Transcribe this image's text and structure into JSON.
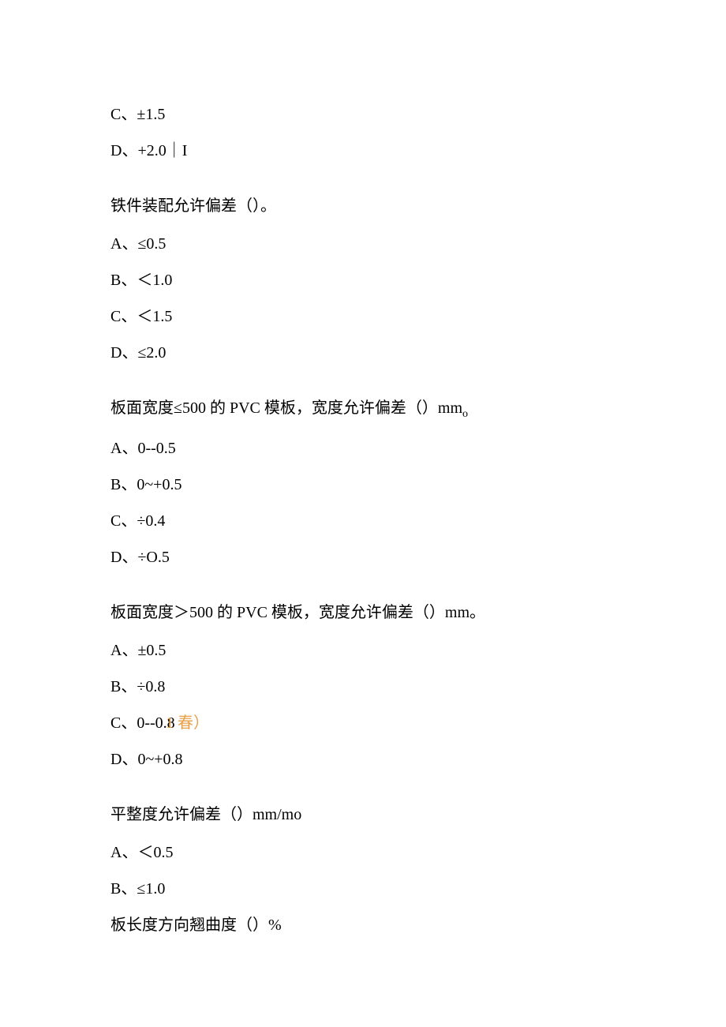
{
  "lines": {
    "opt_c1": "C、±1.5",
    "opt_d1": "D、+2.0｜I",
    "q1": "铁件装配允许偏差（）。",
    "q1_a": "A、≤0.5",
    "q1_b": "B、＜1.0",
    "q1_c": "C、＜1.5",
    "q1_d": "D、≤2.0",
    "q2_prefix": "板面宽度≤500 的 PVC 模板，宽度允许偏差（）mm",
    "q2_suffix": "o",
    "q2_a": "A、0--0.5",
    "q2_b": "B、0~+0.5",
    "q2_c": "C、÷0.4",
    "q2_d": "D、÷O.5",
    "q3": "板面宽度＞500 的 PVC 模板，宽度允许偏差（）mm。",
    "q3_a": "A、±0.5",
    "q3_b": "B、÷0.8",
    "q3_c": "C、0--0.8",
    "q3_c_annotation": "1 春）",
    "q3_d": "D、0~+0.8",
    "q4": "平整度允许偏差（）mm/mo",
    "q4_a": "A、＜0.5",
    "q4_b": "B、≤1.0",
    "q5": "板长度方向翘曲度（）%"
  }
}
